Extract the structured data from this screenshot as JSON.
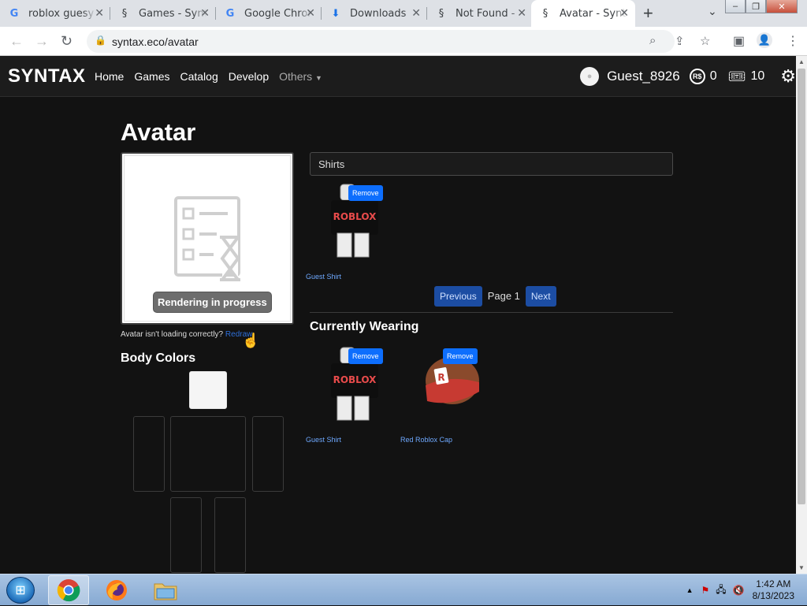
{
  "browser": {
    "tabs": [
      {
        "title": "roblox guesy",
        "icon": "google-icon"
      },
      {
        "title": "Games - Synt",
        "icon": "syntax-icon"
      },
      {
        "title": "Google Chrom",
        "icon": "google-icon"
      },
      {
        "title": "Downloads",
        "icon": "download-icon"
      },
      {
        "title": "Not Found -",
        "icon": "syntax-icon"
      },
      {
        "title": "Avatar - Synt",
        "icon": "syntax-icon"
      }
    ],
    "url": "syntax.eco/avatar"
  },
  "site": {
    "brand": "SYNTAX",
    "nav": [
      "Home",
      "Games",
      "Catalog",
      "Develop"
    ],
    "others": "Others",
    "user": {
      "name": "Guest_8926",
      "robux": "0",
      "tickets": "10"
    }
  },
  "page": {
    "title": "Avatar",
    "render_status": "Rendering in progress",
    "avatar_note": "Avatar isn't loading correctly?",
    "redraw": "Redraw",
    "body_colors_title": "Body Colors",
    "category": "Shirts",
    "inventory": [
      {
        "name": "Guest Shirt",
        "action": "Remove"
      }
    ],
    "pager": {
      "prev": "Previous",
      "label": "Page 1",
      "next": "Next"
    },
    "wearing_title": "Currently Wearing",
    "wearing": [
      {
        "name": "Guest Shirt",
        "action": "Remove"
      },
      {
        "name": "Red Roblox Cap",
        "action": "Remove"
      }
    ]
  },
  "taskbar": {
    "time": "1:42 AM",
    "date": "8/13/2023"
  }
}
